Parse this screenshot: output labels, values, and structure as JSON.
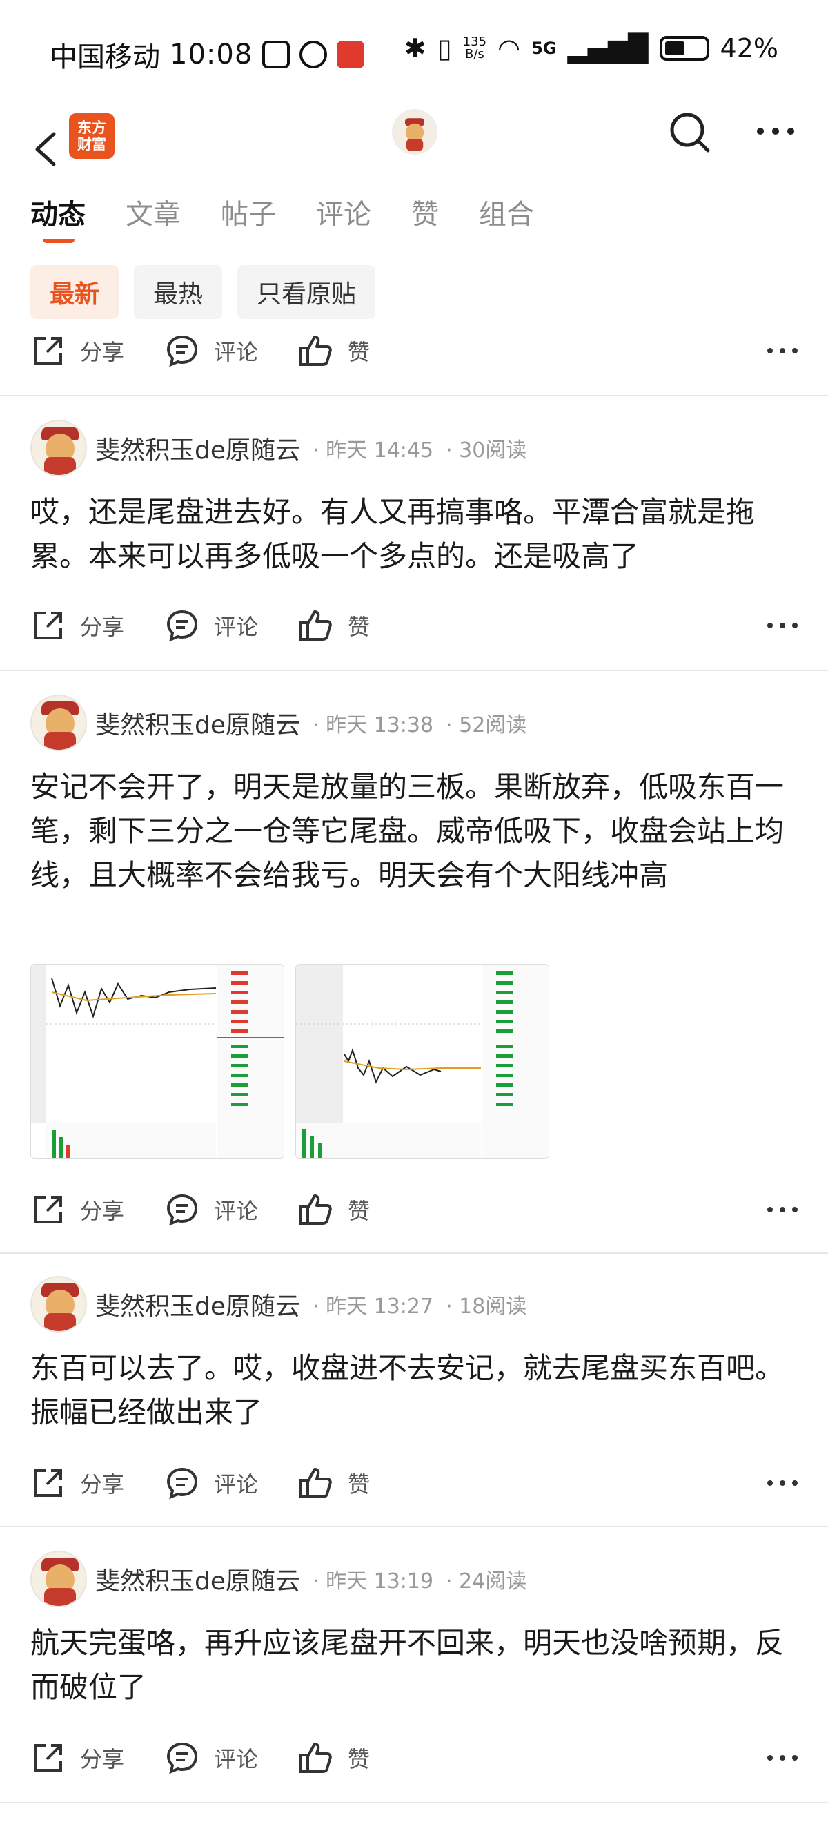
{
  "status_bar": {
    "carrier": "中国移动",
    "time": "10:08",
    "net_speed_top": "135",
    "net_speed_bottom": "B/s",
    "network": "5G",
    "battery": "42%"
  },
  "header": {
    "brand_line1": "东方",
    "brand_line2": "财富"
  },
  "tabs": [
    {
      "label": "动态",
      "active": true
    },
    {
      "label": "文章"
    },
    {
      "label": "帖子"
    },
    {
      "label": "评论"
    },
    {
      "label": "赞"
    },
    {
      "label": "组合"
    }
  ],
  "filters": [
    {
      "label": "最新",
      "active": true
    },
    {
      "label": "最热"
    },
    {
      "label": "只看原贴"
    }
  ],
  "action_labels": {
    "share": "分享",
    "comment": "评论",
    "like": "赞"
  },
  "posts": [
    {
      "username": "斐然积玉de原随云",
      "time": "昨天 14:45",
      "reads": "30阅读",
      "content": "哎，还是尾盘进去好。有人又再搞事咯。平潭合富就是拖累。本来可以再多低吸一个多点的。还是吸高了"
    },
    {
      "username": "斐然积玉de原随云",
      "time": "昨天 13:38",
      "reads": "52阅读",
      "content": "安记不会开了，明天是放量的三板。果断放弃，低吸东百一笔，剩下三分之一仓等它尾盘。威帝低吸下，收盘会站上均线，且大概率不会给我亏。明天会有个大阳线冲高"
    },
    {
      "username": "斐然积玉de原随云",
      "time": "昨天 13:27",
      "reads": "18阅读",
      "content": "东百可以去了。哎，收盘进不去安记，就去尾盘买东百吧。振幅已经做出来了"
    },
    {
      "username": "斐然积玉de原随云",
      "time": "昨天 13:19",
      "reads": "24阅读",
      "content": "航天完蛋咯，再升应该尾盘开不回来，明天也没啥预期，反而破位了"
    }
  ],
  "colors": {
    "accent": "#e8531e",
    "chip_active_bg": "#fdeee5",
    "up": "#e03a2f",
    "down": "#1a9e3a"
  }
}
